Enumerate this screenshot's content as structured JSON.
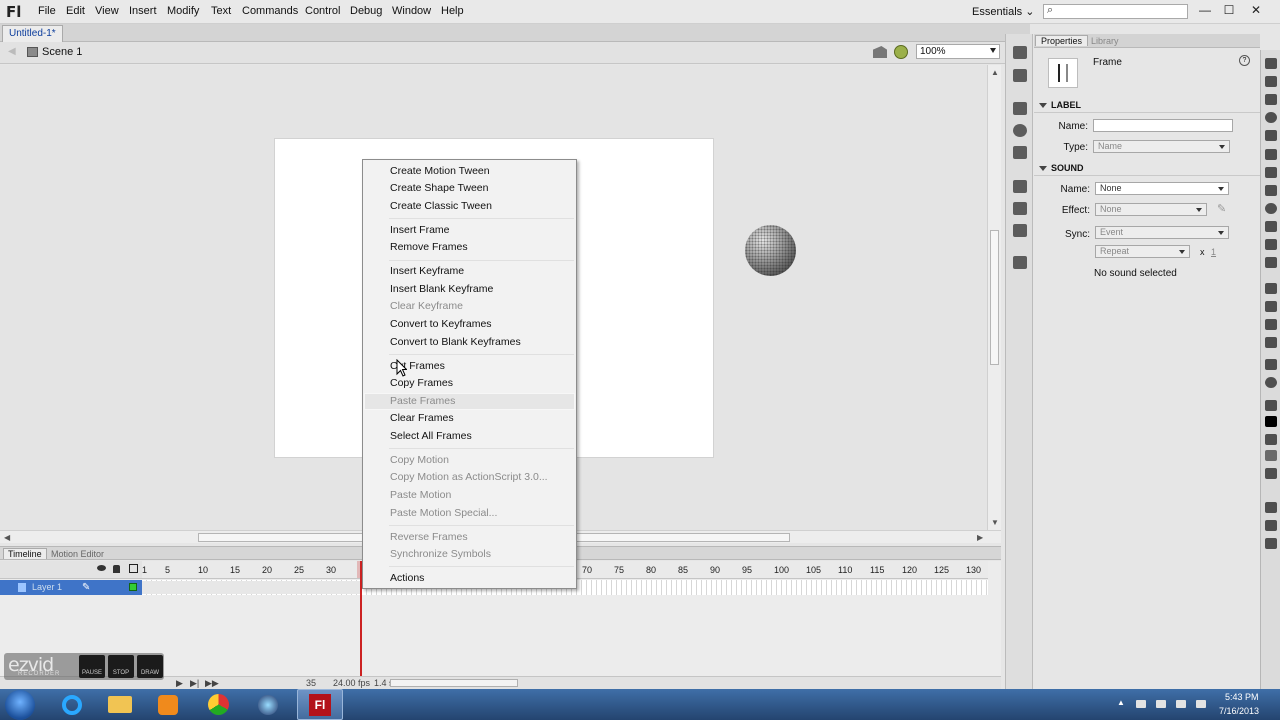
{
  "app": {
    "logo": "Fl",
    "search_glyph": "⌕"
  },
  "menubar": {
    "items": [
      "File",
      "Edit",
      "View",
      "Insert",
      "Modify",
      "Text",
      "Commands",
      "Control",
      "Debug",
      "Window",
      "Help"
    ],
    "workspace": "Essentials ⌄"
  },
  "window_buttons": {
    "minimize": "—",
    "maximize": "☐",
    "close": "✕"
  },
  "document": {
    "tab": "Untitled-1*",
    "scene": "Scene 1",
    "zoom": "100%"
  },
  "timeline": {
    "tabs": [
      "Timeline",
      "Motion Editor"
    ],
    "layer_name": "Layer 1",
    "ruler": [
      "1",
      "5",
      "10",
      "15",
      "20",
      "25",
      "30",
      "70",
      "75",
      "80",
      "85",
      "90",
      "95",
      "100",
      "105",
      "110",
      "115",
      "120",
      "125",
      "130"
    ],
    "current_frame": "35",
    "fps": "24.00 fps",
    "elapsed": "1.4 s"
  },
  "context_menu": {
    "items": [
      {
        "label": "Create Motion Tween",
        "enabled": true
      },
      {
        "label": "Create Shape Tween",
        "enabled": true
      },
      {
        "label": "Create Classic Tween",
        "enabled": true
      },
      {
        "label": "Insert Frame",
        "enabled": true
      },
      {
        "label": "Remove Frames",
        "enabled": true
      },
      {
        "label": "Insert Keyframe",
        "enabled": true
      },
      {
        "label": "Insert Blank Keyframe",
        "enabled": true
      },
      {
        "label": "Clear Keyframe",
        "enabled": false
      },
      {
        "label": "Convert to Keyframes",
        "enabled": true
      },
      {
        "label": "Convert to Blank Keyframes",
        "enabled": true
      },
      {
        "label": "Cut Frames",
        "enabled": true
      },
      {
        "label": "Copy Frames",
        "enabled": true
      },
      {
        "label": "Paste Frames",
        "enabled": false
      },
      {
        "label": "Clear Frames",
        "enabled": true
      },
      {
        "label": "Select All Frames",
        "enabled": true
      },
      {
        "label": "Copy Motion",
        "enabled": false
      },
      {
        "label": "Copy Motion as ActionScript 3.0...",
        "enabled": false
      },
      {
        "label": "Paste Motion",
        "enabled": false
      },
      {
        "label": "Paste Motion Special...",
        "enabled": false
      },
      {
        "label": "Reverse Frames",
        "enabled": false
      },
      {
        "label": "Synchronize Symbols",
        "enabled": false
      },
      {
        "label": "Actions",
        "enabled": true
      }
    ],
    "hovered": "Paste Frames"
  },
  "properties": {
    "tabs": [
      "Properties",
      "Library"
    ],
    "title": "Frame",
    "help_glyph": "?",
    "label_section": "LABEL",
    "name_label": "Name:",
    "name_value": "",
    "type_label": "Type:",
    "type_value": "Name",
    "sound_section": "SOUND",
    "sound_name_label": "Name:",
    "sound_name_value": "None",
    "effect_label": "Effect:",
    "effect_value": "None",
    "sync_label": "Sync:",
    "sync_value": "Event",
    "repeat_value": "Repeat",
    "repeat_x": "x",
    "repeat_count": "1",
    "status": "No sound selected"
  },
  "ezvid": {
    "logo": "ezvid",
    "sublabel": "RECORDER",
    "buttons": [
      "PAUSE",
      "STOP",
      "DRAW"
    ]
  },
  "clock": {
    "time": "5:43 PM",
    "date": "7/16/2013"
  },
  "taskbar": {
    "flash_label": "Fl"
  },
  "colors": {
    "playhead": "#cc2222",
    "layer_selected": "#3f74c8",
    "taskbar": "#2e568c"
  }
}
